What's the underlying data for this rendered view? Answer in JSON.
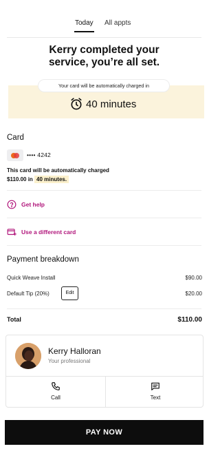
{
  "tabs": [
    {
      "label": "Today",
      "active": true
    },
    {
      "label": "All appts",
      "active": false
    }
  ],
  "headline": "Kerry completed your service, you’re all set.",
  "charge_notice": "Your card will be automatically charged in",
  "countdown": {
    "icon": "alarm-clock-icon",
    "label": "40 minutes"
  },
  "card": {
    "section_title": "Card",
    "brand_icon": "mastercard-icon",
    "masked_number": "•••• 4242",
    "note_line1": "This card will be automatically charged",
    "note_amount_prefix": "$110.00 in",
    "note_time": "40 minutes."
  },
  "actions": {
    "get_help": {
      "label": "Get help",
      "icon": "question-circle-icon"
    },
    "use_different_card": {
      "label": "Use a different card",
      "icon": "card-add-icon"
    }
  },
  "payment_breakdown": {
    "title": "Payment breakdown",
    "items": [
      {
        "label": "Quick Weave Install",
        "amount": "$90.00"
      },
      {
        "label": "Default Tip (20%)",
        "amount": "$20.00",
        "edit_label": "Edit"
      }
    ],
    "total_label": "Total",
    "total_amount": "$110.00"
  },
  "professional": {
    "name": "Kerry Halloran",
    "subtitle": "Your professional",
    "call_label": "Call",
    "text_label": "Text"
  },
  "pay_button": "PAY NOW",
  "colors": {
    "accent": "#b0147a",
    "highlight": "#fbf3dc",
    "primary_button": "#0d0d0d"
  }
}
